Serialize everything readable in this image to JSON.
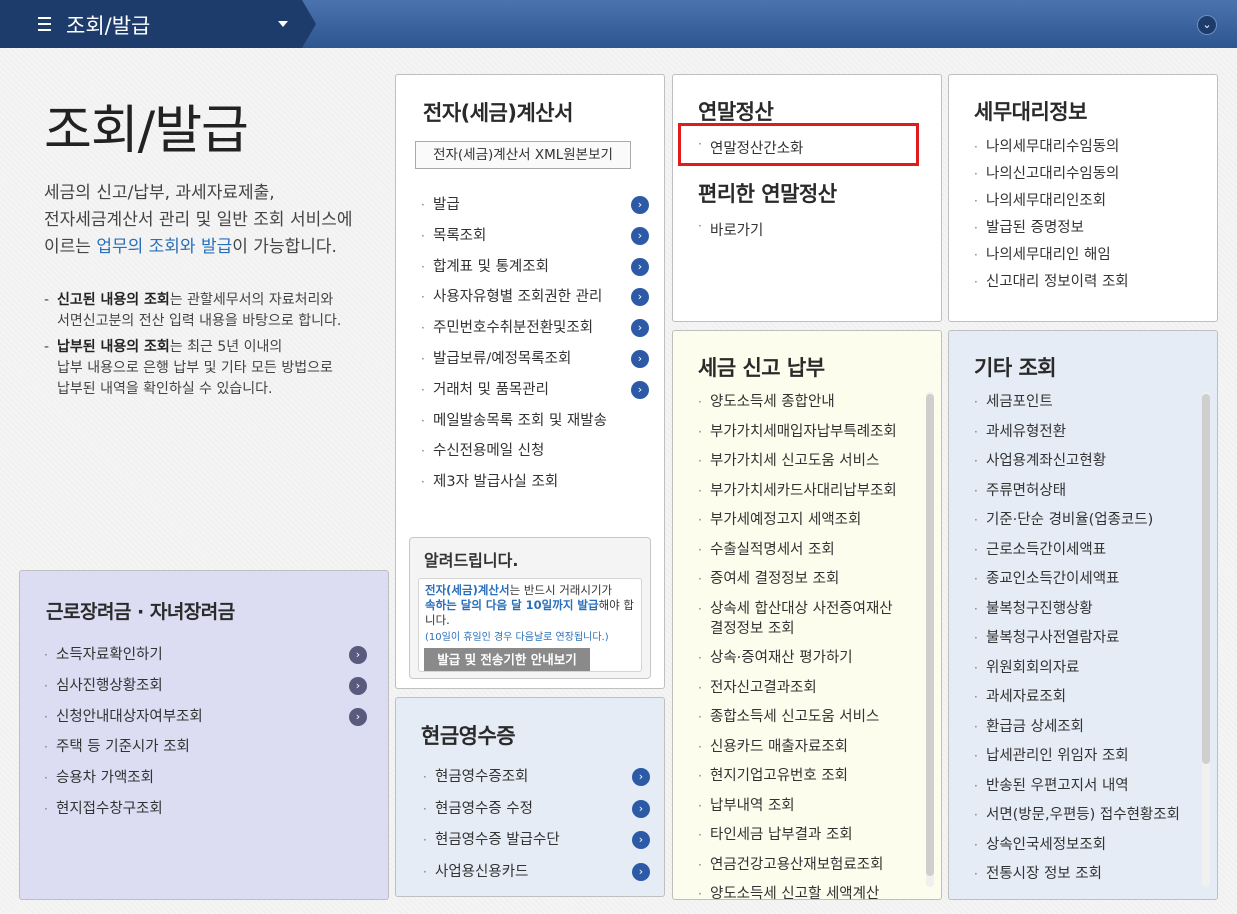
{
  "topbar": {
    "menu_label": "조회/발급",
    "caret_icon": "caret-down-icon",
    "expand_icon": "chevron-down-icon"
  },
  "intro": {
    "title": "조회/발급",
    "line1": "세금의 신고/납부, 과세자료제출,",
    "line2": "전자세금계산서 관리 및 일반 조회 서비스에",
    "line3_pre": "이르는 ",
    "line3_link": "업무의 조회와 발급",
    "line3_post": "이 가능합니다.",
    "notes": [
      {
        "bold": "신고된 내용의 조회",
        "rest1": "는 관할세무서의 자료처리와",
        "rest2": "서면신고분의 전산 입력 내용을 바탕으로 합니다."
      },
      {
        "bold": "납부된 내용의 조회",
        "rest1": "는 최근 5년 이내의",
        "rest2": "납부 내용으로 은행 납부 및 기타 모든 방법으로",
        "rest3": "납부된 내역을 확인하실 수 있습니다."
      }
    ]
  },
  "einvoice": {
    "title": "전자(세금)계산서",
    "xml_button": "전자(세금)계산서 XML원본보기",
    "items": [
      {
        "label": "발급",
        "arrow": true
      },
      {
        "label": "목록조회",
        "arrow": true
      },
      {
        "label": "합계표 및 통계조회",
        "arrow": true
      },
      {
        "label": "사용자유형별 조회권한 관리",
        "arrow": true
      },
      {
        "label": "주민번호수취분전환및조회",
        "arrow": true
      },
      {
        "label": "발급보류/예정목록조회",
        "arrow": true
      },
      {
        "label": "거래처 및 품목관리",
        "arrow": true
      },
      {
        "label": "메일발송목록 조회 및 재발송",
        "arrow": false
      },
      {
        "label": "수신전용메일 신청",
        "arrow": false
      },
      {
        "label": "제3자 발급사실 조회",
        "arrow": false
      }
    ],
    "notice": {
      "title": "알려드립니다.",
      "text_blue1": "전자(세금)계산서",
      "text1": "는 반드시 거래시기가",
      "text_blue2": "속하는 달의 다음 달 10일까지 발급",
      "text2": "해야 합니다.",
      "small": "(10일이 휴일인 경우 다음날로 연장됩니다.)",
      "button": "발급 및 전송기한 안내보기"
    }
  },
  "yearend": {
    "title": "연말정산",
    "item": "연말정산간소화",
    "title2": "편리한 연말정산",
    "item2": "바로가기"
  },
  "taxagent": {
    "title": "세무대리정보",
    "items": [
      "나의세무대리수임동의",
      "나의신고대리수임동의",
      "나의세무대리인조회",
      "발급된 증명정보",
      "나의세무대리인 해임",
      "신고대리 정보이력 조회"
    ]
  },
  "taxfile": {
    "title": "세금 신고 납부",
    "items": [
      "양도소득세 종합안내",
      "부가가치세매입자납부특례조회",
      "부가가치세 신고도움 서비스",
      "부가가치세카드사대리납부조회",
      "부가세예정고지 세액조회",
      "수출실적명세서 조회",
      "증여세 결정정보 조회",
      "상속세 합산대상 사전증여재산|결정정보 조회",
      "상속·증여재산 평가하기",
      "전자신고결과조회",
      "종합소득세 신고도움 서비스",
      "신용카드 매출자료조회",
      "현지기업고유번호 조회",
      "납부내역 조회",
      "타인세금 납부결과 조회",
      "연금건강고용산재보험료조회",
      "양도소득세 신고할 세액계산"
    ]
  },
  "other": {
    "title": "기타 조회",
    "items": [
      "세금포인트",
      "과세유형전환",
      "사업용계좌신고현황",
      "주류면허상태",
      "기준·단순 경비율(업종코드)",
      "근로소득간이세액표",
      "종교인소득간이세액표",
      "불복청구진행상황",
      "불복청구사전열람자료",
      "위원회회의자료",
      "과세자료조회",
      "환급금 상세조회",
      "납세관리인 위임자 조회",
      "반송된 우편고지서 내역",
      "서면(방문,우편등) 접수현황조회",
      "상속인국세정보조회",
      "전통시장 정보 조회"
    ]
  },
  "cash": {
    "title": "현금영수증",
    "items": [
      "현금영수증조회",
      "현금영수증 수정",
      "현금영수증 발급수단",
      "사업용신용카드"
    ]
  },
  "incentive": {
    "title": "근로장려금 · 자녀장려금",
    "items": [
      {
        "label": "소득자료확인하기",
        "arrow": true
      },
      {
        "label": "심사진행상황조회",
        "arrow": true
      },
      {
        "label": "신청안내대상자여부조회",
        "arrow": true
      },
      {
        "label": "주택 등 기준시가 조회",
        "arrow": false
      },
      {
        "label": "승용차 가액조회",
        "arrow": false
      },
      {
        "label": "현지접수창구조회",
        "arrow": false
      }
    ]
  },
  "icons": {
    "arrow": "chevron-right-circle-icon",
    "bullet": "bullet-dot-icon",
    "menu": "hamburger-icon"
  },
  "colors": {
    "topbar": "#2d5690",
    "accent_red": "#e01b1b",
    "link_blue": "#2a6fba"
  }
}
